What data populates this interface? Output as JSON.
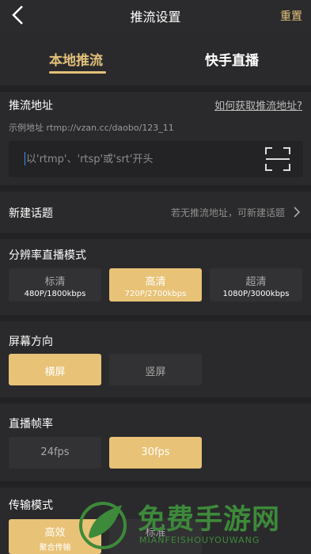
{
  "header": {
    "title": "推流设置",
    "reset_label": "重置"
  },
  "tabs": [
    {
      "label": "本地推流"
    },
    {
      "label": "快手直播"
    }
  ],
  "stream_url": {
    "heading": "推流地址",
    "help_link": "如何获取推流地址?",
    "sample": "示例地址 rtmp://vzan.cc/daobo/123_11",
    "placeholder": "以'rtmp'、'rtsp'或'srt'开头"
  },
  "topic": {
    "label": "新建话题",
    "hint": "若无推流地址，可新建话题"
  },
  "resolution": {
    "heading": "分辨率直播模式",
    "options": [
      {
        "label": "标清",
        "detail": "480P/1800kbps"
      },
      {
        "label": "高清",
        "detail": "720P/2700kbps"
      },
      {
        "label": "超清",
        "detail": "1080P/3000kbps"
      }
    ]
  },
  "orientation": {
    "heading": "屏幕方向",
    "options": [
      {
        "label": "横屏"
      },
      {
        "label": "竖屏"
      }
    ]
  },
  "framerate": {
    "heading": "直播帧率",
    "options": [
      {
        "label": "24fps"
      },
      {
        "label": "30fps"
      }
    ]
  },
  "transport": {
    "heading": "传输模式",
    "options": [
      {
        "label": "高效",
        "detail": "聚合传输"
      },
      {
        "label": "标准"
      }
    ]
  },
  "watermark": {
    "text": "免费手游网",
    "sub": "MIANFEISHOUYOUWANG"
  },
  "colors": {
    "accent": "#e3c17a",
    "background": "#2a2a2c",
    "option_bg": "#323234",
    "selected_bg": "#e8c276"
  },
  "icons": {
    "back": "chevron-left-icon",
    "scan": "scan-icon",
    "chevron": "chevron-right-icon"
  }
}
